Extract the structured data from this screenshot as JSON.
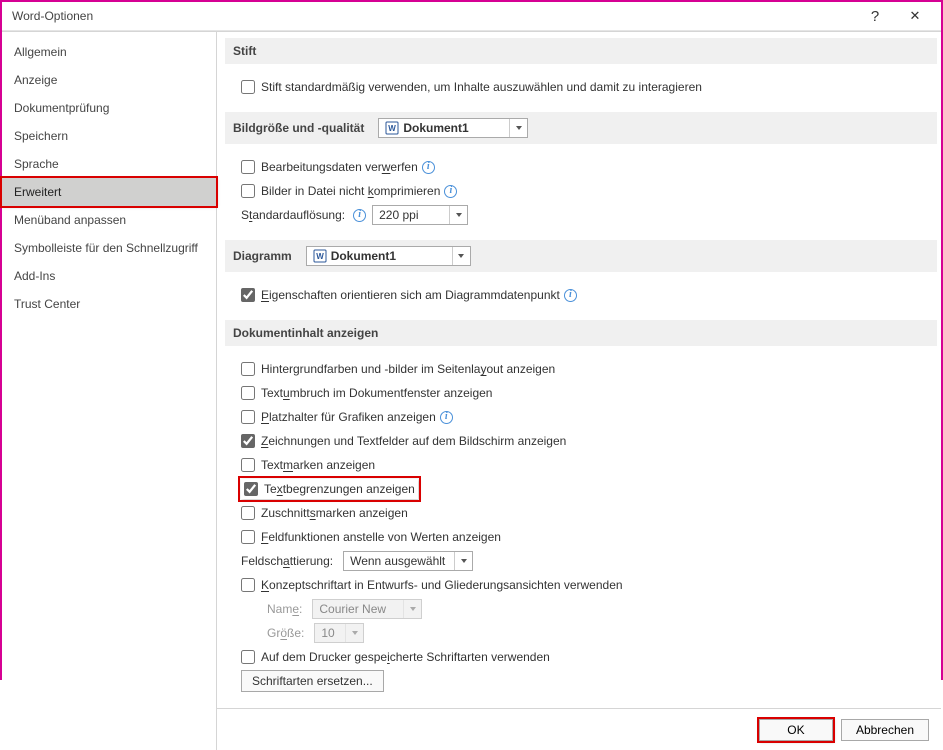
{
  "window": {
    "title": "Word-Optionen"
  },
  "sidebar": {
    "items": [
      {
        "label": "Allgemein",
        "selected": false
      },
      {
        "label": "Anzeige",
        "selected": false
      },
      {
        "label": "Dokumentprüfung",
        "selected": false
      },
      {
        "label": "Speichern",
        "selected": false
      },
      {
        "label": "Sprache",
        "selected": false
      },
      {
        "label": "Erweitert",
        "selected": true
      },
      {
        "label": "Menüband anpassen",
        "selected": false
      },
      {
        "label": "Symbolleiste für den Schnellzugriff",
        "selected": false
      },
      {
        "label": "Add-Ins",
        "selected": false
      },
      {
        "label": "Trust Center",
        "selected": false
      }
    ]
  },
  "sections": {
    "stift": {
      "title": "Stift",
      "use_pen": {
        "label": "Stift standardmäßig verwenden, um Inhalte auszuwählen und damit zu interagieren",
        "checked": false
      }
    },
    "bildgroesse": {
      "title": "Bildgröße und -qualität",
      "target_doc": "Dokument1",
      "discard_edit": {
        "label_prefix": "Bearbeitungsdaten ver",
        "access": "w",
        "label_suffix": "erfen",
        "checked": false
      },
      "no_compress": {
        "label_prefix": "Bilder in Datei nicht ",
        "access": "k",
        "label_suffix": "omprimieren",
        "checked": false
      },
      "resolution_label_prefix": "S",
      "resolution_label_access": "t",
      "resolution_label_suffix": "andardauflösung:",
      "resolution_value": "220 ppi"
    },
    "diagramm": {
      "title": "Diagramm",
      "target_doc": "Dokument1",
      "props_at_point": {
        "access": "E",
        "label_suffix": "igenschaften orientieren sich am Diagrammdatenpunkt",
        "checked": true
      }
    },
    "dokinhalt": {
      "title": "Dokumentinhalt anzeigen",
      "bg_colors": {
        "label_prefix": "Hintergrundfarben und -bilder im Seitenla",
        "access": "y",
        "label_suffix": "out anzeigen",
        "checked": false
      },
      "wrap": {
        "label_prefix": "Text",
        "access": "u",
        "label_suffix": "mbruch im Dokumentfenster anzeigen",
        "checked": false
      },
      "placeholders": {
        "access": "P",
        "label_suffix": "latzhalter für Grafiken anzeigen",
        "checked": false
      },
      "drawings": {
        "access": "Z",
        "label_suffix": "eichnungen und Textfelder auf dem Bildschirm anzeigen",
        "checked": true
      },
      "bookmarks": {
        "label_prefix": "Text",
        "access": "m",
        "label_suffix": "arken anzeigen",
        "checked": false
      },
      "textboundaries": {
        "label_prefix": "Te",
        "access": "x",
        "label_suffix": "tbegrenzungen anzeigen",
        "checked": true
      },
      "cropmarks": {
        "label_prefix": "Zuschnitt",
        "access": "s",
        "label_suffix": "marken anzeigen",
        "checked": false
      },
      "fieldcodes": {
        "access": "F",
        "label_suffix": "eldfunktionen anstelle von Werten anzeigen",
        "checked": false
      },
      "fieldshading_label_prefix": "Feldsch",
      "fieldshading_access": "a",
      "fieldshading_label_suffix": "ttierung:",
      "fieldshading_value": "Wenn ausgewählt",
      "draftfont": {
        "access": "K",
        "label_suffix": "onzeptschriftart in Entwurfs- und Gliederungsansichten verwenden",
        "checked": false
      },
      "fontname_label": "Nam",
      "fontname_access": "e",
      "fontname_suffix": ":",
      "fontname_value": "Courier New",
      "fontsize_label": "Gr",
      "fontsize_access": "ö",
      "fontsize_suffix": "ße:",
      "fontsize_value": "10",
      "printerfonts": {
        "label_prefix": "Auf dem Drucker gespe",
        "access": "i",
        "label_suffix": "cherte Schriftarten verwenden",
        "checked": false
      },
      "replace_fonts_btn": "Schriftarten ersetzen..."
    }
  },
  "footer": {
    "ok": "OK",
    "cancel": "Abbrechen"
  }
}
